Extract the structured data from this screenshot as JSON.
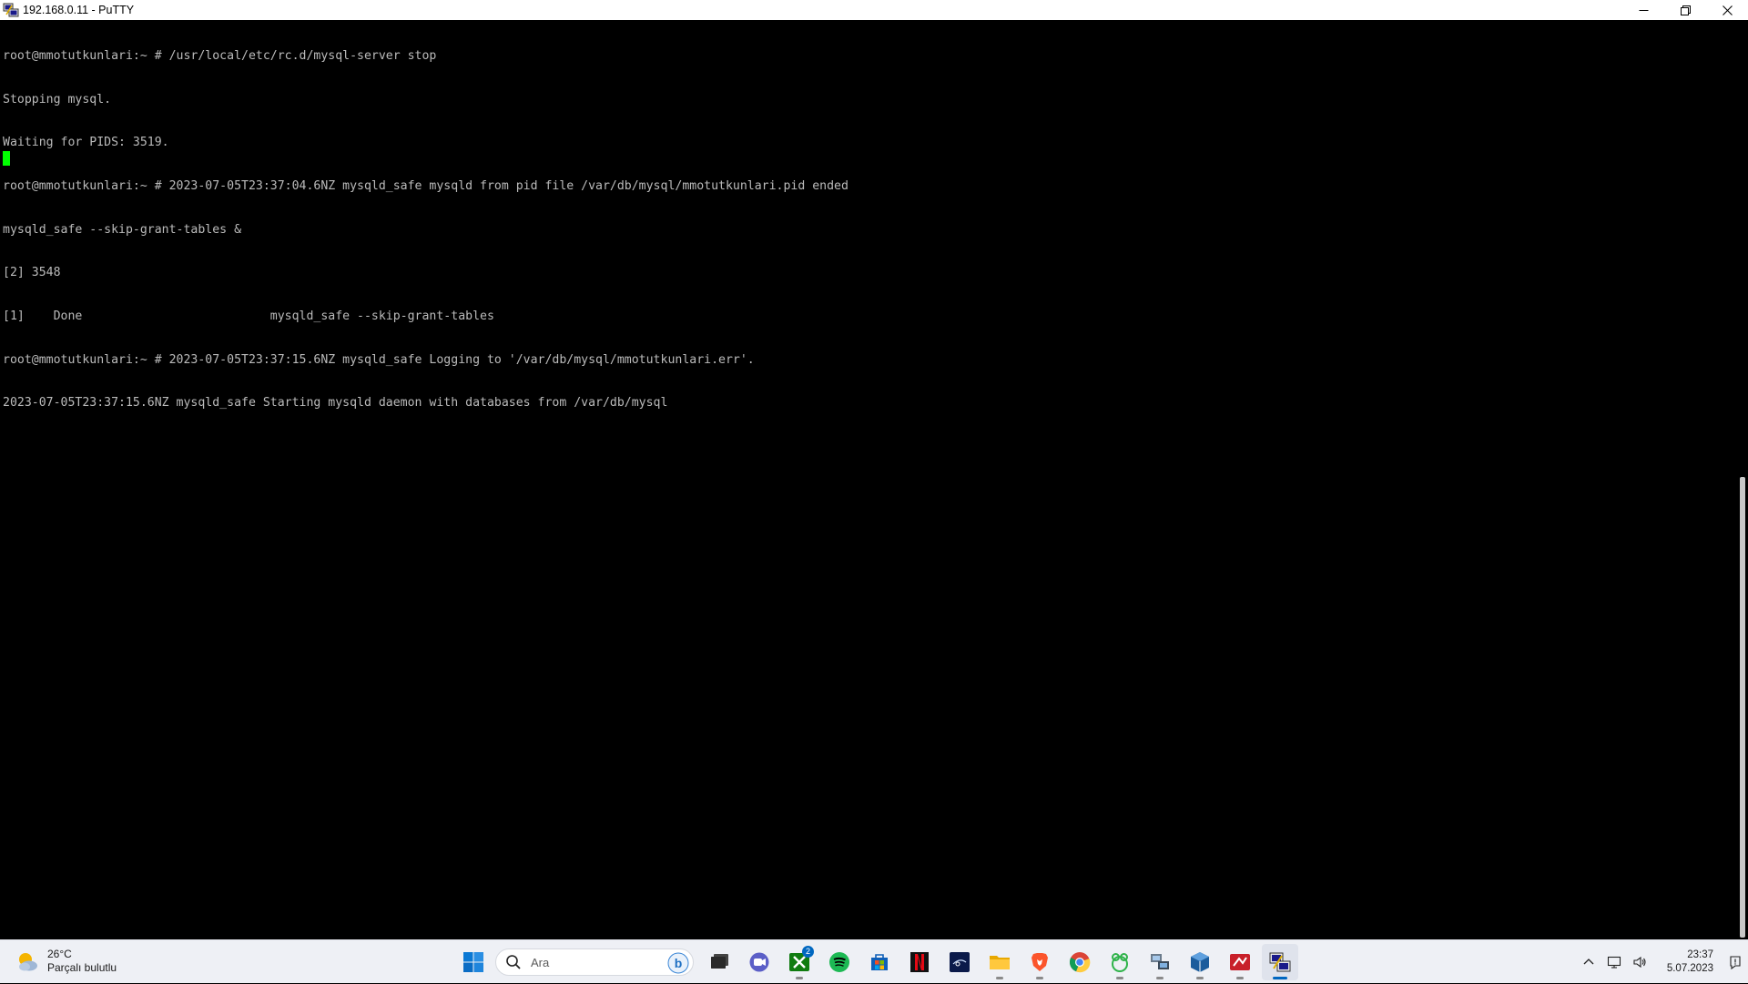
{
  "window": {
    "title": "192.168.0.11 - PuTTY",
    "icon": "putty-icon",
    "controls": [
      "minimize-icon",
      "restore-icon",
      "close-icon"
    ]
  },
  "terminal": {
    "foreground": "#bbbbbb",
    "background": "#000000",
    "cursor_color": "#00ff00",
    "lines": [
      "root@mmotutkunlari:~ # /usr/local/etc/rc.d/mysql-server stop",
      "Stopping mysql.",
      "Waiting for PIDS: 3519.",
      "root@mmotutkunlari:~ # 2023-07-05T23:37:04.6NZ mysqld_safe mysqld from pid file /var/db/mysql/mmotutkunlari.pid ended",
      "mysqld_safe --skip-grant-tables &",
      "[2] 3548",
      "[1]    Done                          mysqld_safe --skip-grant-tables",
      "root@mmotutkunlari:~ # 2023-07-05T23:37:15.6NZ mysqld_safe Logging to '/var/db/mysql/mmotutkunlari.err'.",
      "2023-07-05T23:37:15.6NZ mysqld_safe Starting mysqld daemon with databases from /var/db/mysql"
    ]
  },
  "taskbar": {
    "weather": {
      "temp": "26°C",
      "condition": "Parçalı bulutlu",
      "icon": "partly-cloudy-icon"
    },
    "search": {
      "placeholder": "Ara"
    },
    "apps": [
      {
        "name": "start",
        "icon": "windows-start-icon"
      },
      {
        "name": "task-view",
        "icon": "task-view-icon"
      },
      {
        "name": "teams-chat",
        "icon": "chat-icon"
      },
      {
        "name": "xbox",
        "icon": "xbox-icon",
        "badge": "2"
      },
      {
        "name": "spotify",
        "icon": "spotify-icon"
      },
      {
        "name": "microsoft-store",
        "icon": "store-icon"
      },
      {
        "name": "netflix",
        "icon": "netflix-icon"
      },
      {
        "name": "disney-plus",
        "icon": "disney-plus-icon"
      },
      {
        "name": "file-explorer",
        "icon": "folder-icon"
      },
      {
        "name": "brave",
        "icon": "brave-icon"
      },
      {
        "name": "chrome",
        "icon": "chrome-icon"
      },
      {
        "name": "frog-app",
        "icon": "frog-icon"
      },
      {
        "name": "network-app",
        "icon": "network-tool-icon"
      },
      {
        "name": "virtualbox",
        "icon": "virtualbox-icon"
      },
      {
        "name": "filezilla-like",
        "icon": "red-app-icon"
      },
      {
        "name": "putty",
        "icon": "putty-icon",
        "active": true
      }
    ],
    "tray": {
      "icons": [
        "chevron-up-icon",
        "network-icon",
        "volume-icon"
      ],
      "time": "23:37",
      "date": "5.07.2023",
      "notification_icon": "notification-icon"
    }
  }
}
